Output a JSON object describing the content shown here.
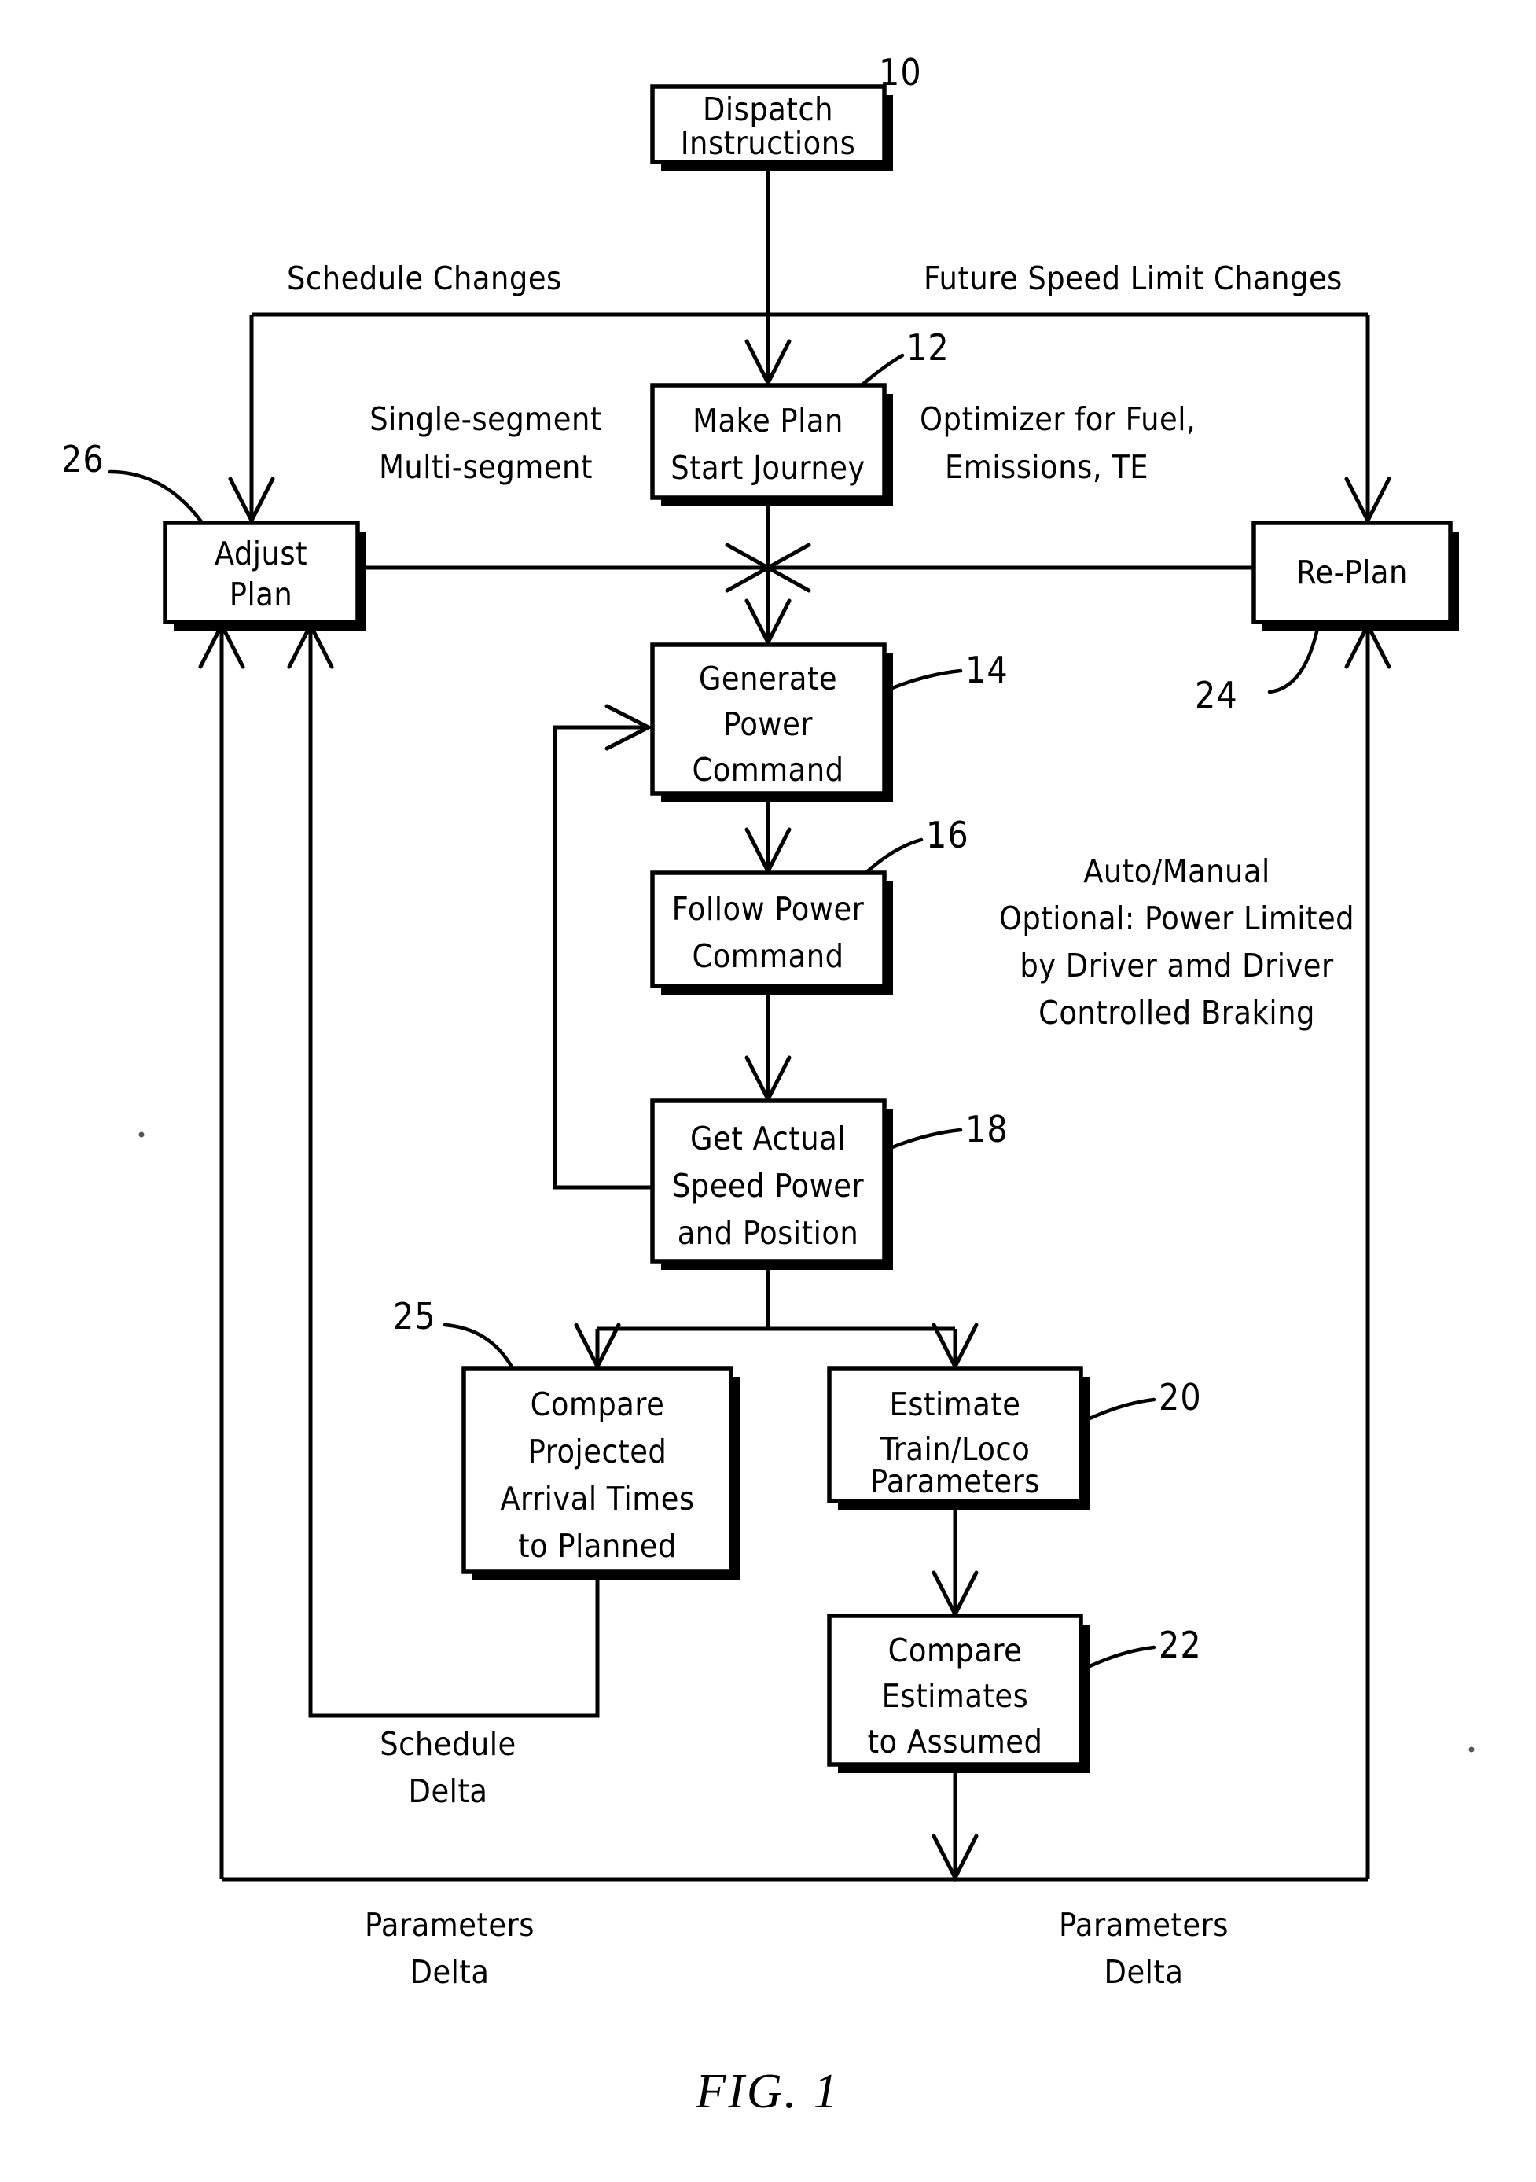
{
  "figure": {
    "caption": "FIG.  1",
    "boxes": [
      {
        "id": "dispatch",
        "ref": "10",
        "lines": [
          "Dispatch",
          "Instructions"
        ]
      },
      {
        "id": "make_plan",
        "ref": "12",
        "lines": [
          "Make Plan",
          "Start Journey"
        ]
      },
      {
        "id": "adjust_plan",
        "ref": "26",
        "lines": [
          "Adjust",
          "Plan"
        ]
      },
      {
        "id": "replan",
        "ref": "24",
        "lines": [
          "Re-Plan"
        ]
      },
      {
        "id": "generate_power",
        "ref": "14",
        "lines": [
          "Generate",
          "Power",
          "Command"
        ]
      },
      {
        "id": "follow_power",
        "ref": "16",
        "lines": [
          "Follow Power",
          "Command"
        ]
      },
      {
        "id": "get_actual",
        "ref": "18",
        "lines": [
          "Get Actual",
          "Speed Power",
          "and Position"
        ]
      },
      {
        "id": "compare_times",
        "ref": "25",
        "lines": [
          "Compare",
          "Projected",
          "Arrival Times",
          "to Planned"
        ]
      },
      {
        "id": "estimate_params",
        "ref": "20",
        "lines": [
          "Estimate",
          "Train/Loco",
          "Parameters"
        ]
      },
      {
        "id": "compare_est",
        "ref": "22",
        "lines": [
          "Compare",
          "Estimates",
          "to Assumed"
        ]
      }
    ],
    "annotations": {
      "schedule_changes": "Schedule Changes",
      "future_speed_limit_changes": "Future Speed Limit Changes",
      "segment_line1": "Single-segment",
      "segment_line2": "Multi-segment",
      "optimizer_line1": "Optimizer for Fuel,",
      "optimizer_line2": "Emissions, TE",
      "auto_manual_line1": "Auto/Manual",
      "auto_manual_line2": "Optional: Power Limited",
      "auto_manual_line3": "by Driver amd Driver",
      "auto_manual_line4": "Controlled Braking",
      "schedule_delta_line1": "Schedule",
      "schedule_delta_line2": "Delta",
      "parameters_delta_left_line1": "Parameters",
      "parameters_delta_left_line2": "Delta",
      "parameters_delta_right_line1": "Parameters",
      "parameters_delta_right_line2": "Delta"
    },
    "colors": {
      "ink": "#000000",
      "paper": "#ffffff"
    }
  }
}
